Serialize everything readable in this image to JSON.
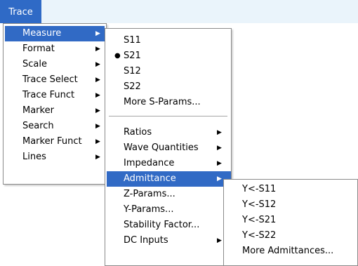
{
  "menubar": {
    "trace_label": "Trace"
  },
  "menu1": {
    "items": [
      {
        "label": "Measure"
      },
      {
        "label": "Format"
      },
      {
        "label": "Scale"
      },
      {
        "label": "Trace Select"
      },
      {
        "label": "Trace Funct"
      },
      {
        "label": "Marker"
      },
      {
        "label": "Search"
      },
      {
        "label": "Marker Funct"
      },
      {
        "label": "Lines"
      }
    ]
  },
  "menu2": {
    "items": [
      {
        "label": "S11"
      },
      {
        "label": "S21"
      },
      {
        "label": "S12"
      },
      {
        "label": "S22"
      },
      {
        "label": "More S-Params..."
      },
      {
        "label": "Ratios"
      },
      {
        "label": "Wave Quantities"
      },
      {
        "label": "Impedance"
      },
      {
        "label": "Admittance"
      },
      {
        "label": "Z-Params..."
      },
      {
        "label": "Y-Params..."
      },
      {
        "label": "Stability Factor..."
      },
      {
        "label": "DC Inputs"
      }
    ],
    "checked_item": "S21"
  },
  "menu3": {
    "items": [
      {
        "label": "Y<-S11"
      },
      {
        "label": "Y<-S12"
      },
      {
        "label": "Y<-S21"
      },
      {
        "label": "Y<-S22"
      },
      {
        "label": "More Admittances..."
      }
    ]
  },
  "colors": {
    "highlight": "#316ac5",
    "menubar_bg": "#eaf4fb",
    "menu_border": "#8a8a8a"
  }
}
